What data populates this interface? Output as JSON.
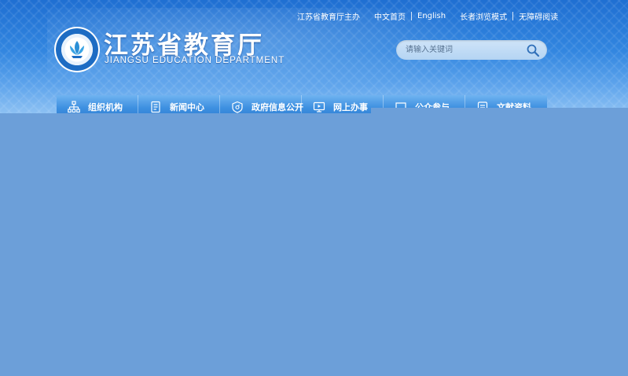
{
  "top_links": {
    "sponsor": "江苏省教育厅主办",
    "home_cn": "中文首页",
    "english": "English",
    "elder_mode": "长者浏览模式",
    "accessible": "无障碍阅读"
  },
  "logo": {
    "name_cn": "江苏省教育厅",
    "name_en": "JIANGSU EDUCATION DEPARTMENT"
  },
  "search": {
    "placeholder": "请输入关键词"
  },
  "nav": {
    "items": [
      {
        "label": "组织机构",
        "icon": "org-chart-icon"
      },
      {
        "label": "新闻中心",
        "icon": "news-icon"
      },
      {
        "label": "政府信息公开",
        "icon": "info-disclosure-icon"
      },
      {
        "label": "网上办事",
        "icon": "online-service-icon"
      },
      {
        "label": "公众参与",
        "icon": "public-participation-icon"
      },
      {
        "label": "文献资料",
        "icon": "documents-icon"
      }
    ]
  },
  "colors": {
    "header_top": "#1f6fd2",
    "header_bottom": "#8dc1f3",
    "nav": "#3d8fe0",
    "overlay": "#6c9fd9"
  }
}
